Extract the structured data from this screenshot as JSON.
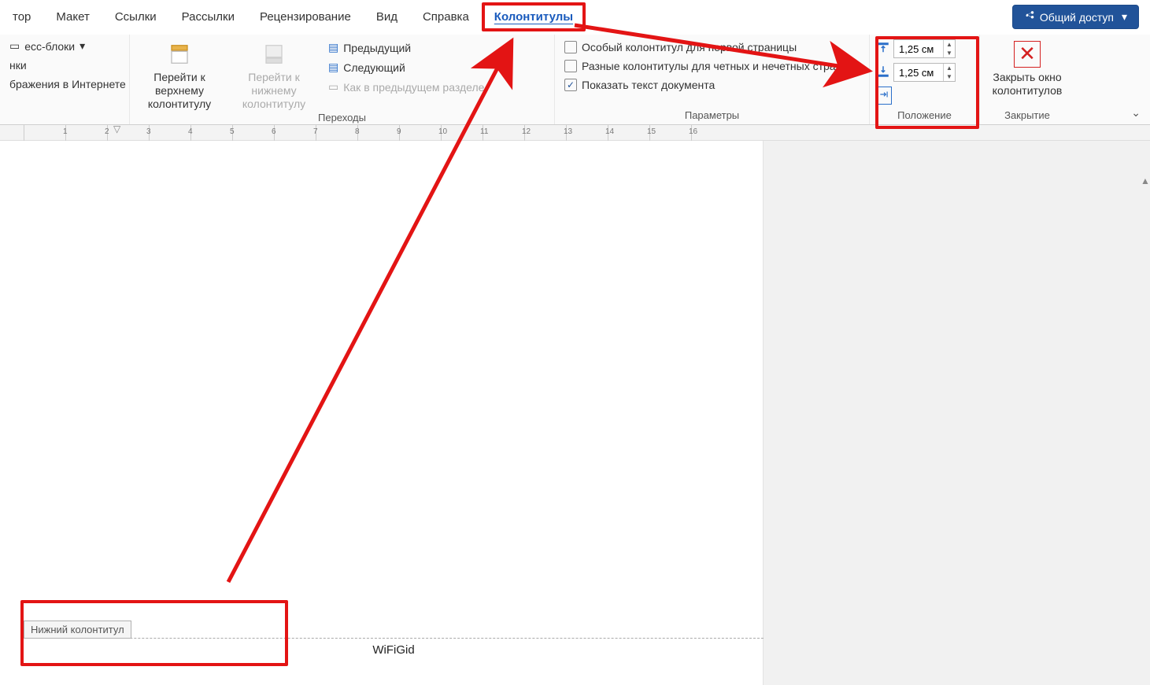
{
  "tabs": {
    "items": [
      "тор",
      "Макет",
      "Ссылки",
      "Рассылки",
      "Рецензирование",
      "Вид",
      "Справка",
      "Колонтитулы"
    ],
    "active_index": 7
  },
  "share_button": "Общий доступ",
  "ribbon": {
    "left_group": {
      "express_blocks": "есс-блоки",
      "pictures": "нки",
      "online_images": "бражения в Интернете"
    },
    "navigation": {
      "go_to_header": "Перейти к верхнему колонтитулу",
      "go_to_footer": "Перейти к нижнему колонтитулу",
      "previous": "Предыдущий",
      "next": "Следующий",
      "same_as_prev": "Как в предыдущем разделе",
      "group_label": "Переходы"
    },
    "options": {
      "first_page_different": "Особый колонтитул для первой страницы",
      "odd_even_different": "Разные колонтитулы для четных и нечетных страниц",
      "show_document_text": "Показать текст документа",
      "show_document_text_checked": true,
      "group_label": "Параметры"
    },
    "position": {
      "header_from_top": "1,25 см",
      "footer_from_bottom": "1,25 см",
      "group_label": "Положение"
    },
    "close": {
      "label": "Закрыть окно колонтитулов",
      "group_label": "Закрытие"
    }
  },
  "ruler": {
    "marks": [
      "",
      "1",
      "2",
      "3",
      "4",
      "5",
      "6",
      "7",
      "8",
      "9",
      "10",
      "11",
      "12",
      "13",
      "14",
      "15",
      "16"
    ],
    "page_number": "1"
  },
  "document": {
    "footer_tag": "Нижний колонтитул",
    "footer_text": "WiFiGid"
  },
  "icons": {
    "share": "share-icon",
    "express": "blocks-icon",
    "picture": "picture-icon",
    "online_picture": "online-picture-icon",
    "header_nav": "header-nav-icon",
    "footer_nav": "footer-nav-icon",
    "prev": "prev-section-icon",
    "next": "next-section-icon",
    "link_prev": "link-prev-icon",
    "from_top": "from-top-icon",
    "from_bottom": "from-bottom-icon",
    "insert_tab": "insert-tab-icon",
    "close_x": "close-x-icon",
    "chevron": "chevron-down-icon",
    "collapse": "collapse-ribbon-icon"
  }
}
